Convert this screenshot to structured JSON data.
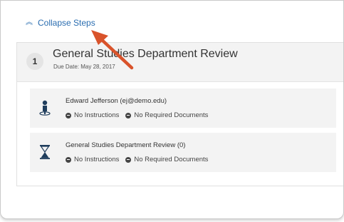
{
  "collapse": {
    "label": "Collapse Steps",
    "icon": "double-chevron-up-icon"
  },
  "step": {
    "number": "1",
    "title": "General Studies Department Review",
    "due_date": "Due Date: May 28, 2017"
  },
  "items": [
    {
      "title": "Edward Jefferson (ej@demo.edu)",
      "icon": "person-icon",
      "instructions": "No Instructions",
      "documents": "No Required Documents"
    },
    {
      "title": "General Studies Department Review (0)",
      "icon": "hourglass-icon",
      "instructions": "No Instructions",
      "documents": "No Required Documents"
    }
  ],
  "colors": {
    "link": "#2a6db0",
    "annotation_arrow": "#d9532b"
  }
}
